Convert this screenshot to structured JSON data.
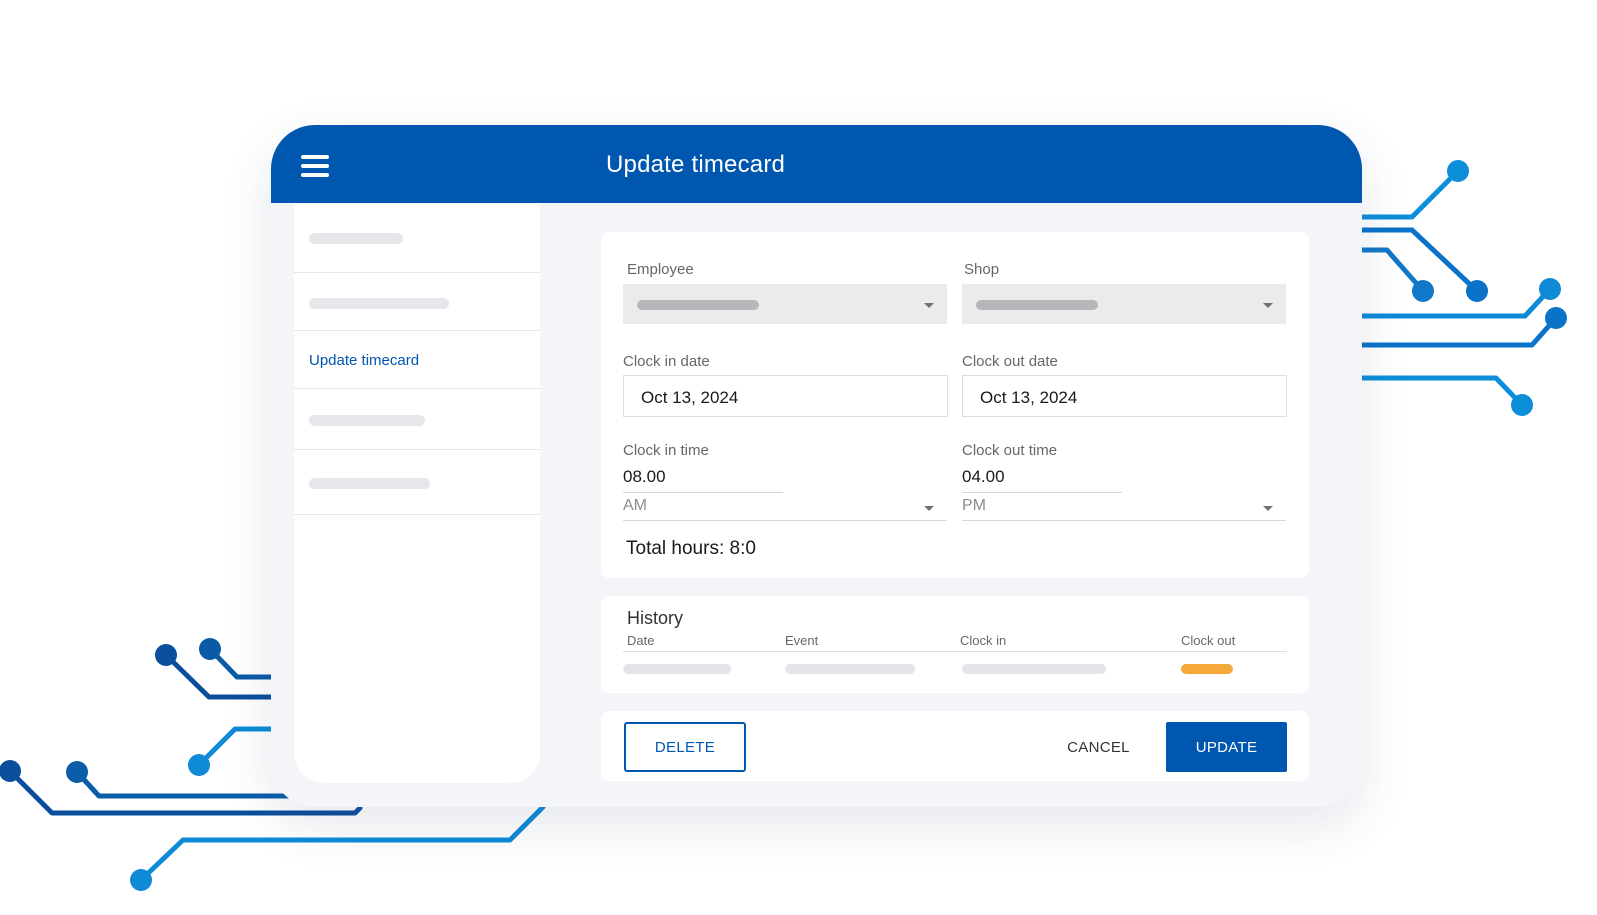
{
  "header": {
    "title": "Update timecard"
  },
  "sidebar": {
    "active_label": "Update timecard"
  },
  "form": {
    "employee_label": "Employee",
    "shop_label": "Shop",
    "clock_in_date_label": "Clock in date",
    "clock_in_date_value": "Oct 13, 2024",
    "clock_out_date_label": "Clock out date",
    "clock_out_date_value": "Oct 13, 2024",
    "clock_in_time_label": "Clock in time",
    "clock_in_time_value": "08.00",
    "clock_in_period": "AM",
    "clock_out_time_label": "Clock out time",
    "clock_out_time_value": "04.00",
    "clock_out_period": "PM",
    "total_hours": "Total hours: 8:0"
  },
  "history": {
    "title": "History",
    "columns": [
      "Date",
      "Event",
      "Clock in",
      "Clock out"
    ]
  },
  "actions": {
    "delete": "DELETE",
    "cancel": "CANCEL",
    "update": "UPDATE"
  },
  "colors": {
    "primary": "#0057b0",
    "accent": "#f5a93b",
    "circuit": "#0a72c9"
  }
}
